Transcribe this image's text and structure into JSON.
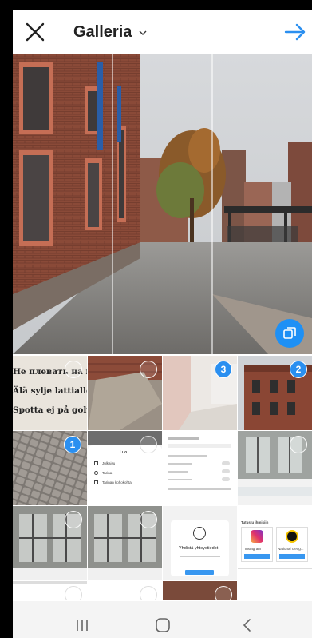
{
  "header": {
    "title": "Galleria",
    "close_icon": "close-icon",
    "dropdown_icon": "chevron-down-icon",
    "next_icon": "arrow-right-icon",
    "accent_color": "#2a8ff0"
  },
  "preview": {
    "multi_select_icon": "multi-select-icon"
  },
  "grid": {
    "sign_lines": [
      "Не плевать на пол",
      "Älä sylje lattialle",
      "Spotta ej på golvet"
    ],
    "selections": [
      {
        "cell": "sign-photo",
        "selected": false
      },
      {
        "cell": "wall-corner-photo",
        "selected": false
      },
      {
        "cell": "street-photo",
        "selected": true,
        "order": "3"
      },
      {
        "cell": "building-photo",
        "selected": true,
        "order": "2"
      },
      {
        "cell": "cobblestone-photo",
        "selected": true,
        "order": "1"
      },
      {
        "cell": "menu-screenshot",
        "selected": false
      },
      {
        "cell": "settings-screenshot",
        "selected": false
      },
      {
        "cell": "window-photo-1",
        "selected": false
      },
      {
        "cell": "window-photo-2",
        "selected": false
      },
      {
        "cell": "window-photo-3",
        "selected": false
      },
      {
        "cell": "connect-screenshot",
        "selected": false
      },
      {
        "cell": "profiles-screenshot",
        "selected": false
      }
    ],
    "menu_screenshot": {
      "title": "Luo",
      "items": [
        "Julkaisu",
        "Tarina",
        "Tarinan kohokohta"
      ]
    },
    "connect_screenshot": {
      "title": "Yhdistä yhteystiedot"
    },
    "profiles_screenshot": {
      "header": "Tutustu ihmisiin",
      "names": [
        "Instagram",
        "National Geog..."
      ],
      "button": "Seuraa"
    }
  },
  "navbar": {
    "recents_icon": "recents-icon",
    "home_icon": "home-icon",
    "back_icon": "back-icon"
  }
}
